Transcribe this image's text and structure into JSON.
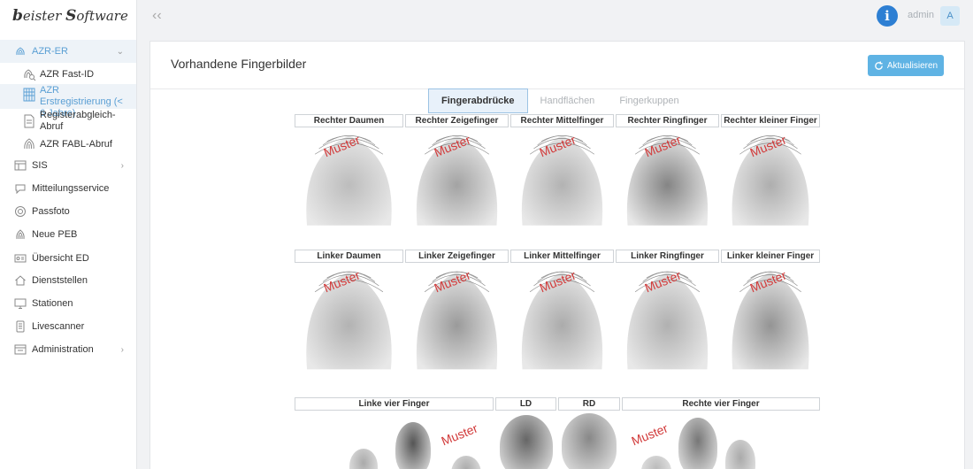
{
  "app": {
    "logo_first_cap": "b",
    "logo_first": "eister ",
    "logo_second_cap": "S",
    "logo_second": "oftware"
  },
  "sidebar": {
    "group": {
      "label": "AZR-ER",
      "icon": "fingerprint-icon"
    },
    "sub_items": [
      {
        "label": "AZR Fast-ID",
        "icon": "fingerprint-search-icon"
      },
      {
        "label": "AZR Erstregistrierung (< 6 Jahre)",
        "icon": "fingerprint-grid-icon"
      },
      {
        "label": "Registerabgleich-Abruf",
        "icon": "document-icon"
      },
      {
        "label": "AZR FABL-Abruf",
        "icon": "fingerprint-icon"
      }
    ],
    "items": [
      {
        "label": "SIS",
        "icon": "grid-icon",
        "has_children": true
      },
      {
        "label": "Mitteilungsservice",
        "icon": "chat-icon",
        "has_children": false
      },
      {
        "label": "Passfoto",
        "icon": "camera-icon",
        "has_children": false
      },
      {
        "label": "Neue PEB",
        "icon": "fingerprint-icon",
        "has_children": false
      },
      {
        "label": "Übersicht ED",
        "icon": "id-card-icon",
        "has_children": false
      },
      {
        "label": "Dienststellen",
        "icon": "home-icon",
        "has_children": false
      },
      {
        "label": "Stationen",
        "icon": "monitor-icon",
        "has_children": false
      },
      {
        "label": "Livescanner",
        "icon": "scanner-icon",
        "has_children": false
      },
      {
        "label": "Administration",
        "icon": "admin-icon",
        "has_children": true
      }
    ]
  },
  "topbar": {
    "user": "admin",
    "avatar_letter": "A",
    "info_glyph": "i"
  },
  "main": {
    "title": "Vorhandene Fingerbilder",
    "refresh_label": "Aktualisieren",
    "tabs": [
      {
        "label": "Fingerabdrücke",
        "active": true
      },
      {
        "label": "Handflächen",
        "active": false
      },
      {
        "label": "Fingerkuppen",
        "active": false
      }
    ],
    "watermark": "Muster",
    "right_hand": [
      "Rechter Daumen",
      "Rechter Zeigefinger",
      "Rechter Mittelfinger",
      "Rechter Ringfinger",
      "Rechter kleiner Finger"
    ],
    "left_hand": [
      "Linker Daumen",
      "Linker Zeigefinger",
      "Linker Mittelfinger",
      "Linker Ringfinger",
      "Linker kleiner Finger"
    ],
    "slaps": [
      "Linke vier Finger",
      "LD",
      "RD",
      "Rechte vier Finger"
    ]
  },
  "colors": {
    "accent": "#5fb3e4",
    "info": "#2d7fd3",
    "watermark": "#d23c3c",
    "active_bg": "#eef3f8"
  }
}
